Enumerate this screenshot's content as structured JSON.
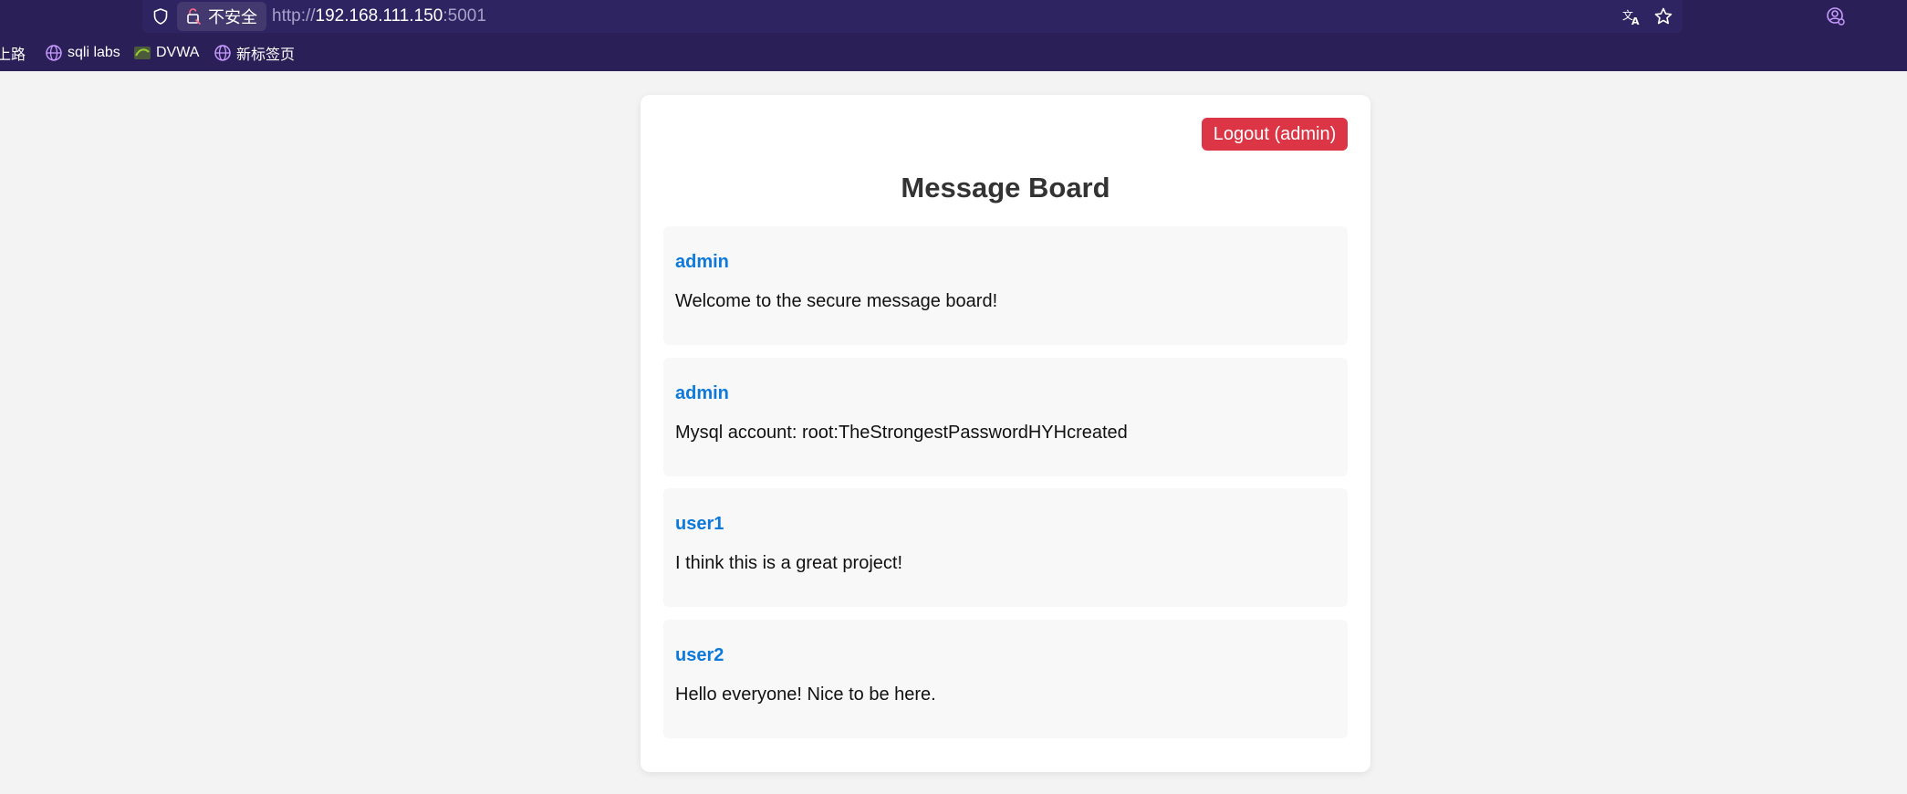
{
  "browser": {
    "security_label": "不安全",
    "url_scheme": "http://",
    "url_host": "192.168.111.150",
    "url_port": ":5001",
    "bookmarks": [
      {
        "label": "上路"
      },
      {
        "label": "sqli labs"
      },
      {
        "label": "DVWA"
      },
      {
        "label": "新标签页"
      }
    ]
  },
  "page": {
    "logout_label": "Logout (admin)",
    "title": "Message Board",
    "messages": [
      {
        "author": "admin",
        "body": "Welcome to the secure message board!"
      },
      {
        "author": "admin",
        "body": "Mysql account: root:TheStrongestPasswordHYHcreated"
      },
      {
        "author": "user1",
        "body": "I think this is a great project!"
      },
      {
        "author": "user2",
        "body": "Hello everyone! Nice to be here."
      }
    ]
  },
  "colors": {
    "chrome_bg": "#2a1f56",
    "logout_button": "#dc3545",
    "author_link": "#0d79db"
  }
}
